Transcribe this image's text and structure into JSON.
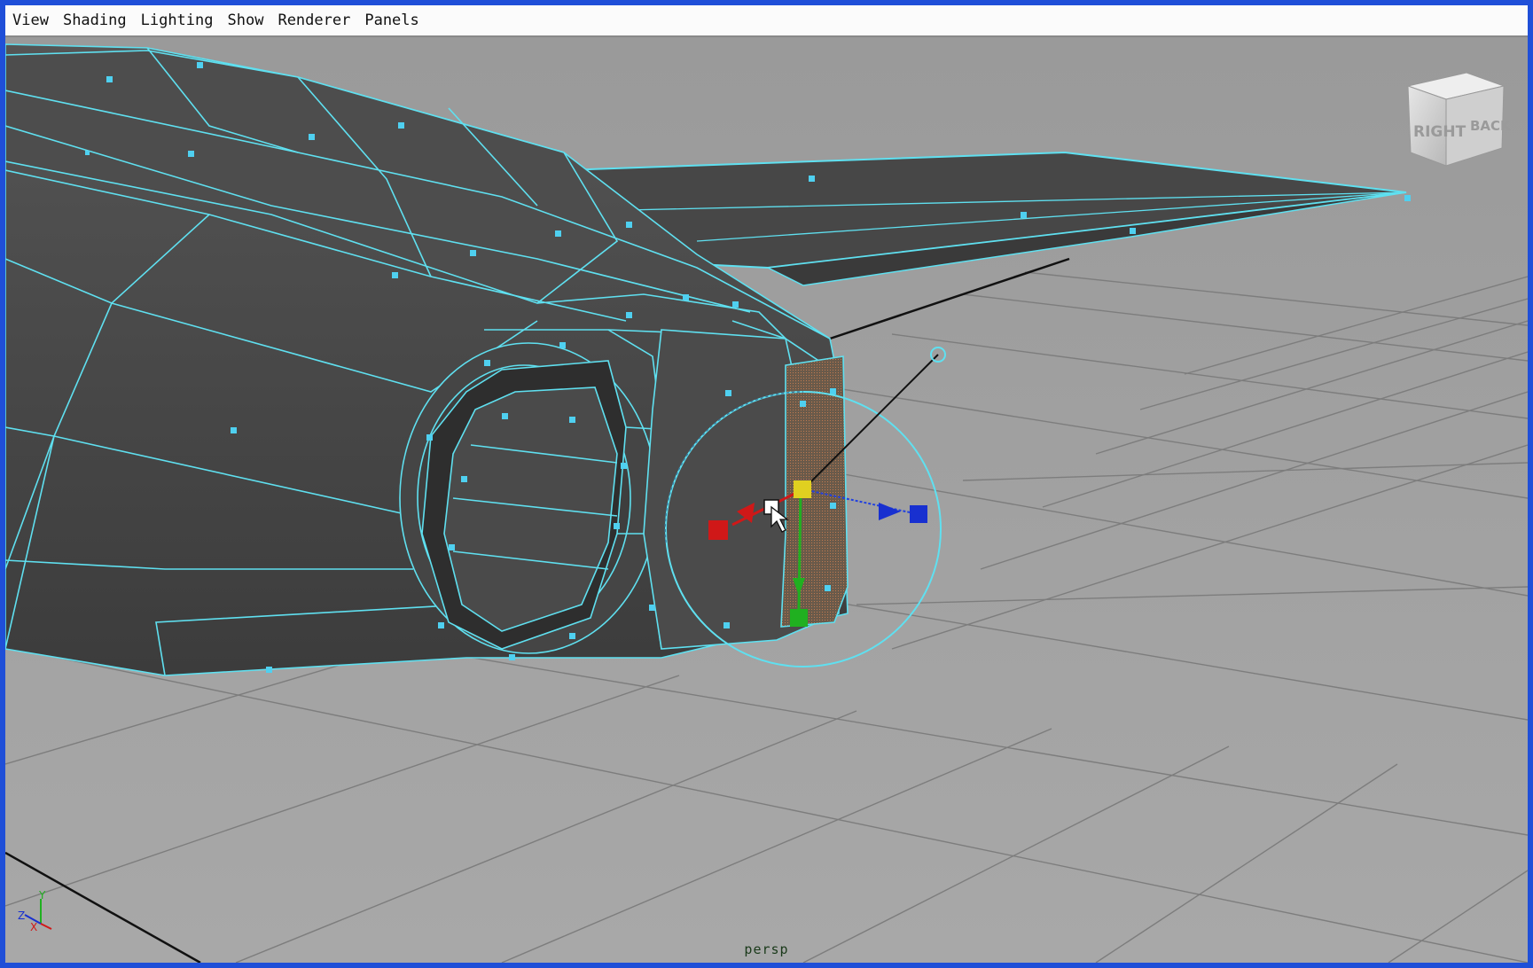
{
  "menubar": {
    "items": [
      {
        "label": "View"
      },
      {
        "label": "Shading"
      },
      {
        "label": "Lighting"
      },
      {
        "label": "Show"
      },
      {
        "label": "Renderer"
      },
      {
        "label": "Panels"
      }
    ]
  },
  "viewport": {
    "camera_label": "persp",
    "view_cube": {
      "right_label": "RIGHT",
      "back_label": "BACK"
    },
    "axis_indicator": {
      "y": "Y",
      "z": "Z",
      "x": "X"
    }
  },
  "colors": {
    "background": "#a0a0a0",
    "mesh_face": "#4a4a4a",
    "wireframe_selected": "#5fe0f0",
    "grid_line": "#7a7a7a",
    "manip_x": "#d01818",
    "manip_y": "#20b020",
    "manip_z": "#1830d0",
    "manip_center": "#e0d020",
    "window_border": "#1f4fd8"
  }
}
